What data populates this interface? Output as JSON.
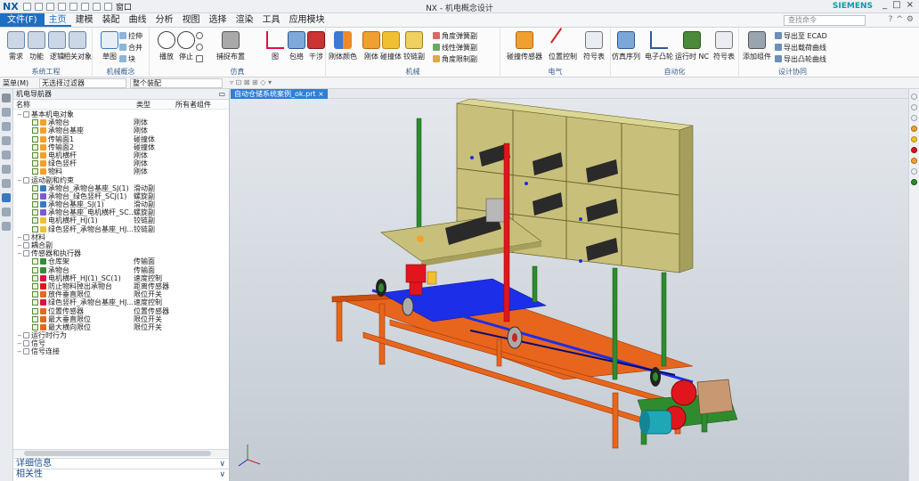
{
  "app": {
    "logo": "NX",
    "window_title": "NX - 机电概念设计",
    "window_menu": "窗口",
    "brand": "SIEMENS",
    "win_controls": [
      "_",
      "□",
      "×"
    ]
  },
  "menu": {
    "tabs": [
      "文件(F)",
      "主页",
      "建模",
      "装配",
      "曲线",
      "分析",
      "视图",
      "选择",
      "渲染",
      "工具",
      "应用模块"
    ],
    "active": "主页",
    "search_placeholder": "查找命令"
  },
  "ribbon": {
    "groups": [
      "系统工程",
      "机械概念",
      "仿真",
      "机械",
      "电气",
      "自动化",
      "设计协同"
    ],
    "buttons": {
      "req": "需求",
      "func": "功能",
      "logic": "逻辑",
      "related": "相关对象",
      "sketch": "草图",
      "extrude": "拉伸",
      "combine": "合并",
      "block": "块",
      "play": "播放",
      "stop": "停止",
      "capture": "捕捉布置",
      "graph": "图",
      "envelope": "包络",
      "interfere": "干涉",
      "body_color": "刚体颜色",
      "rigid": "刚体",
      "collision": "碰撞体",
      "hinge": "铰链副",
      "angle_spring": "角度弹簧副",
      "linear_spring": "线性弹簧副",
      "angle_limit": "角度限制副",
      "coll_sensor": "碰撞传感器",
      "pos_ctrl": "位置控制",
      "symbol_table": "符号表",
      "sim_seq": "仿真序列",
      "e_cam": "电子凸轮",
      "run_nc": "运行时 NC",
      "symbol_table2": "符号表",
      "add_comp": "添加组件",
      "export_ecad": "导出至 ECAD",
      "export_load": "导出载荷曲线",
      "export_cam": "导出凸轮曲线"
    }
  },
  "selbar": {
    "menu": "菜单(M)",
    "filter": "无选择过滤器",
    "assembly": "整个装配"
  },
  "navigator": {
    "title": "机电导航器",
    "columns": [
      "名称",
      "类型",
      "所有者组件"
    ],
    "rows": [
      {
        "name": "基本机电对象",
        "type": "",
        "level": 0,
        "icon": "folder"
      },
      {
        "name": "承物台",
        "type": "刚体",
        "level": 1,
        "icon": "body"
      },
      {
        "name": "承物台基座",
        "type": "刚体",
        "level": 1,
        "icon": "body"
      },
      {
        "name": "传输面1",
        "type": "碰撞体",
        "level": 1,
        "icon": "body"
      },
      {
        "name": "传输面2",
        "type": "碰撞体",
        "level": 1,
        "icon": "body"
      },
      {
        "name": "电机横杆",
        "type": "刚体",
        "level": 1,
        "icon": "body"
      },
      {
        "name": "绿色竖杆",
        "type": "刚体",
        "level": 1,
        "icon": "body"
      },
      {
        "name": "物料",
        "type": "刚体",
        "level": 1,
        "icon": "body"
      },
      {
        "name": "运动副和约束",
        "type": "",
        "level": 0,
        "icon": "folder"
      },
      {
        "name": "承物台_承物台基座_SJ(1)",
        "type": "滑动副",
        "level": 1,
        "icon": "joint"
      },
      {
        "name": "承物台_绿色竖杆_SCJ(1)",
        "type": "螺旋副",
        "level": 1,
        "icon": "screw"
      },
      {
        "name": "承物台基座_SJ(1)",
        "type": "滑动副",
        "level": 1,
        "icon": "joint"
      },
      {
        "name": "承物台基座_电机横杆_SC...",
        "type": "螺旋副",
        "level": 1,
        "icon": "screw"
      },
      {
        "name": "电机横杆_HJ(1)",
        "type": "铰链副",
        "level": 1,
        "icon": "hinge"
      },
      {
        "name": "绿色竖杆_承物台基座_HJ...",
        "type": "铰链副",
        "level": 1,
        "icon": "hinge"
      },
      {
        "name": "材料",
        "type": "",
        "level": 0,
        "icon": "folder"
      },
      {
        "name": "耦合副",
        "type": "",
        "level": 0,
        "icon": "folder"
      },
      {
        "name": "传感器和执行器",
        "type": "",
        "level": 0,
        "icon": "folder"
      },
      {
        "name": "仓库架",
        "type": "传输面",
        "level": 1,
        "icon": "conv"
      },
      {
        "name": "承物台",
        "type": "传输面",
        "level": 1,
        "icon": "conv"
      },
      {
        "name": "电机横杆_HJ(1)_SC(1)",
        "type": "速度控制",
        "level": 1,
        "icon": "speed"
      },
      {
        "name": "防止物料掉出承物台",
        "type": "距离传感器",
        "level": 1,
        "icon": "sensor"
      },
      {
        "name": "放件垂直限位",
        "type": "限位开关",
        "level": 1,
        "icon": "limit"
      },
      {
        "name": "绿色竖杆_承物台基座_HJ...",
        "type": "速度控制",
        "level": 1,
        "icon": "speed"
      },
      {
        "name": "位置传感器",
        "type": "位置传感器",
        "level": 1,
        "icon": "pos"
      },
      {
        "name": "最大垂直限位",
        "type": "限位开关",
        "level": 1,
        "icon": "limit"
      },
      {
        "name": "最大横向限位",
        "type": "限位开关",
        "level": 1,
        "icon": "limit"
      },
      {
        "name": "运行时行为",
        "type": "",
        "level": 0,
        "icon": "folder"
      },
      {
        "name": "信号",
        "type": "",
        "level": 0,
        "icon": "folder"
      },
      {
        "name": "信号连接",
        "type": "",
        "level": 0,
        "icon": "folder"
      }
    ],
    "bottom_panels": [
      "详细信息",
      "相关性"
    ]
  },
  "document": {
    "tab": "自动仓储系统案例_ok.prt"
  },
  "colors": {
    "accent": "#1d6fc3",
    "shelf": "#c8c07a",
    "orange": "#e8651d",
    "blue": "#1c2ee8",
    "green": "#2e8b2e",
    "red": "#e0161c",
    "teal": "#1fa7b8"
  }
}
